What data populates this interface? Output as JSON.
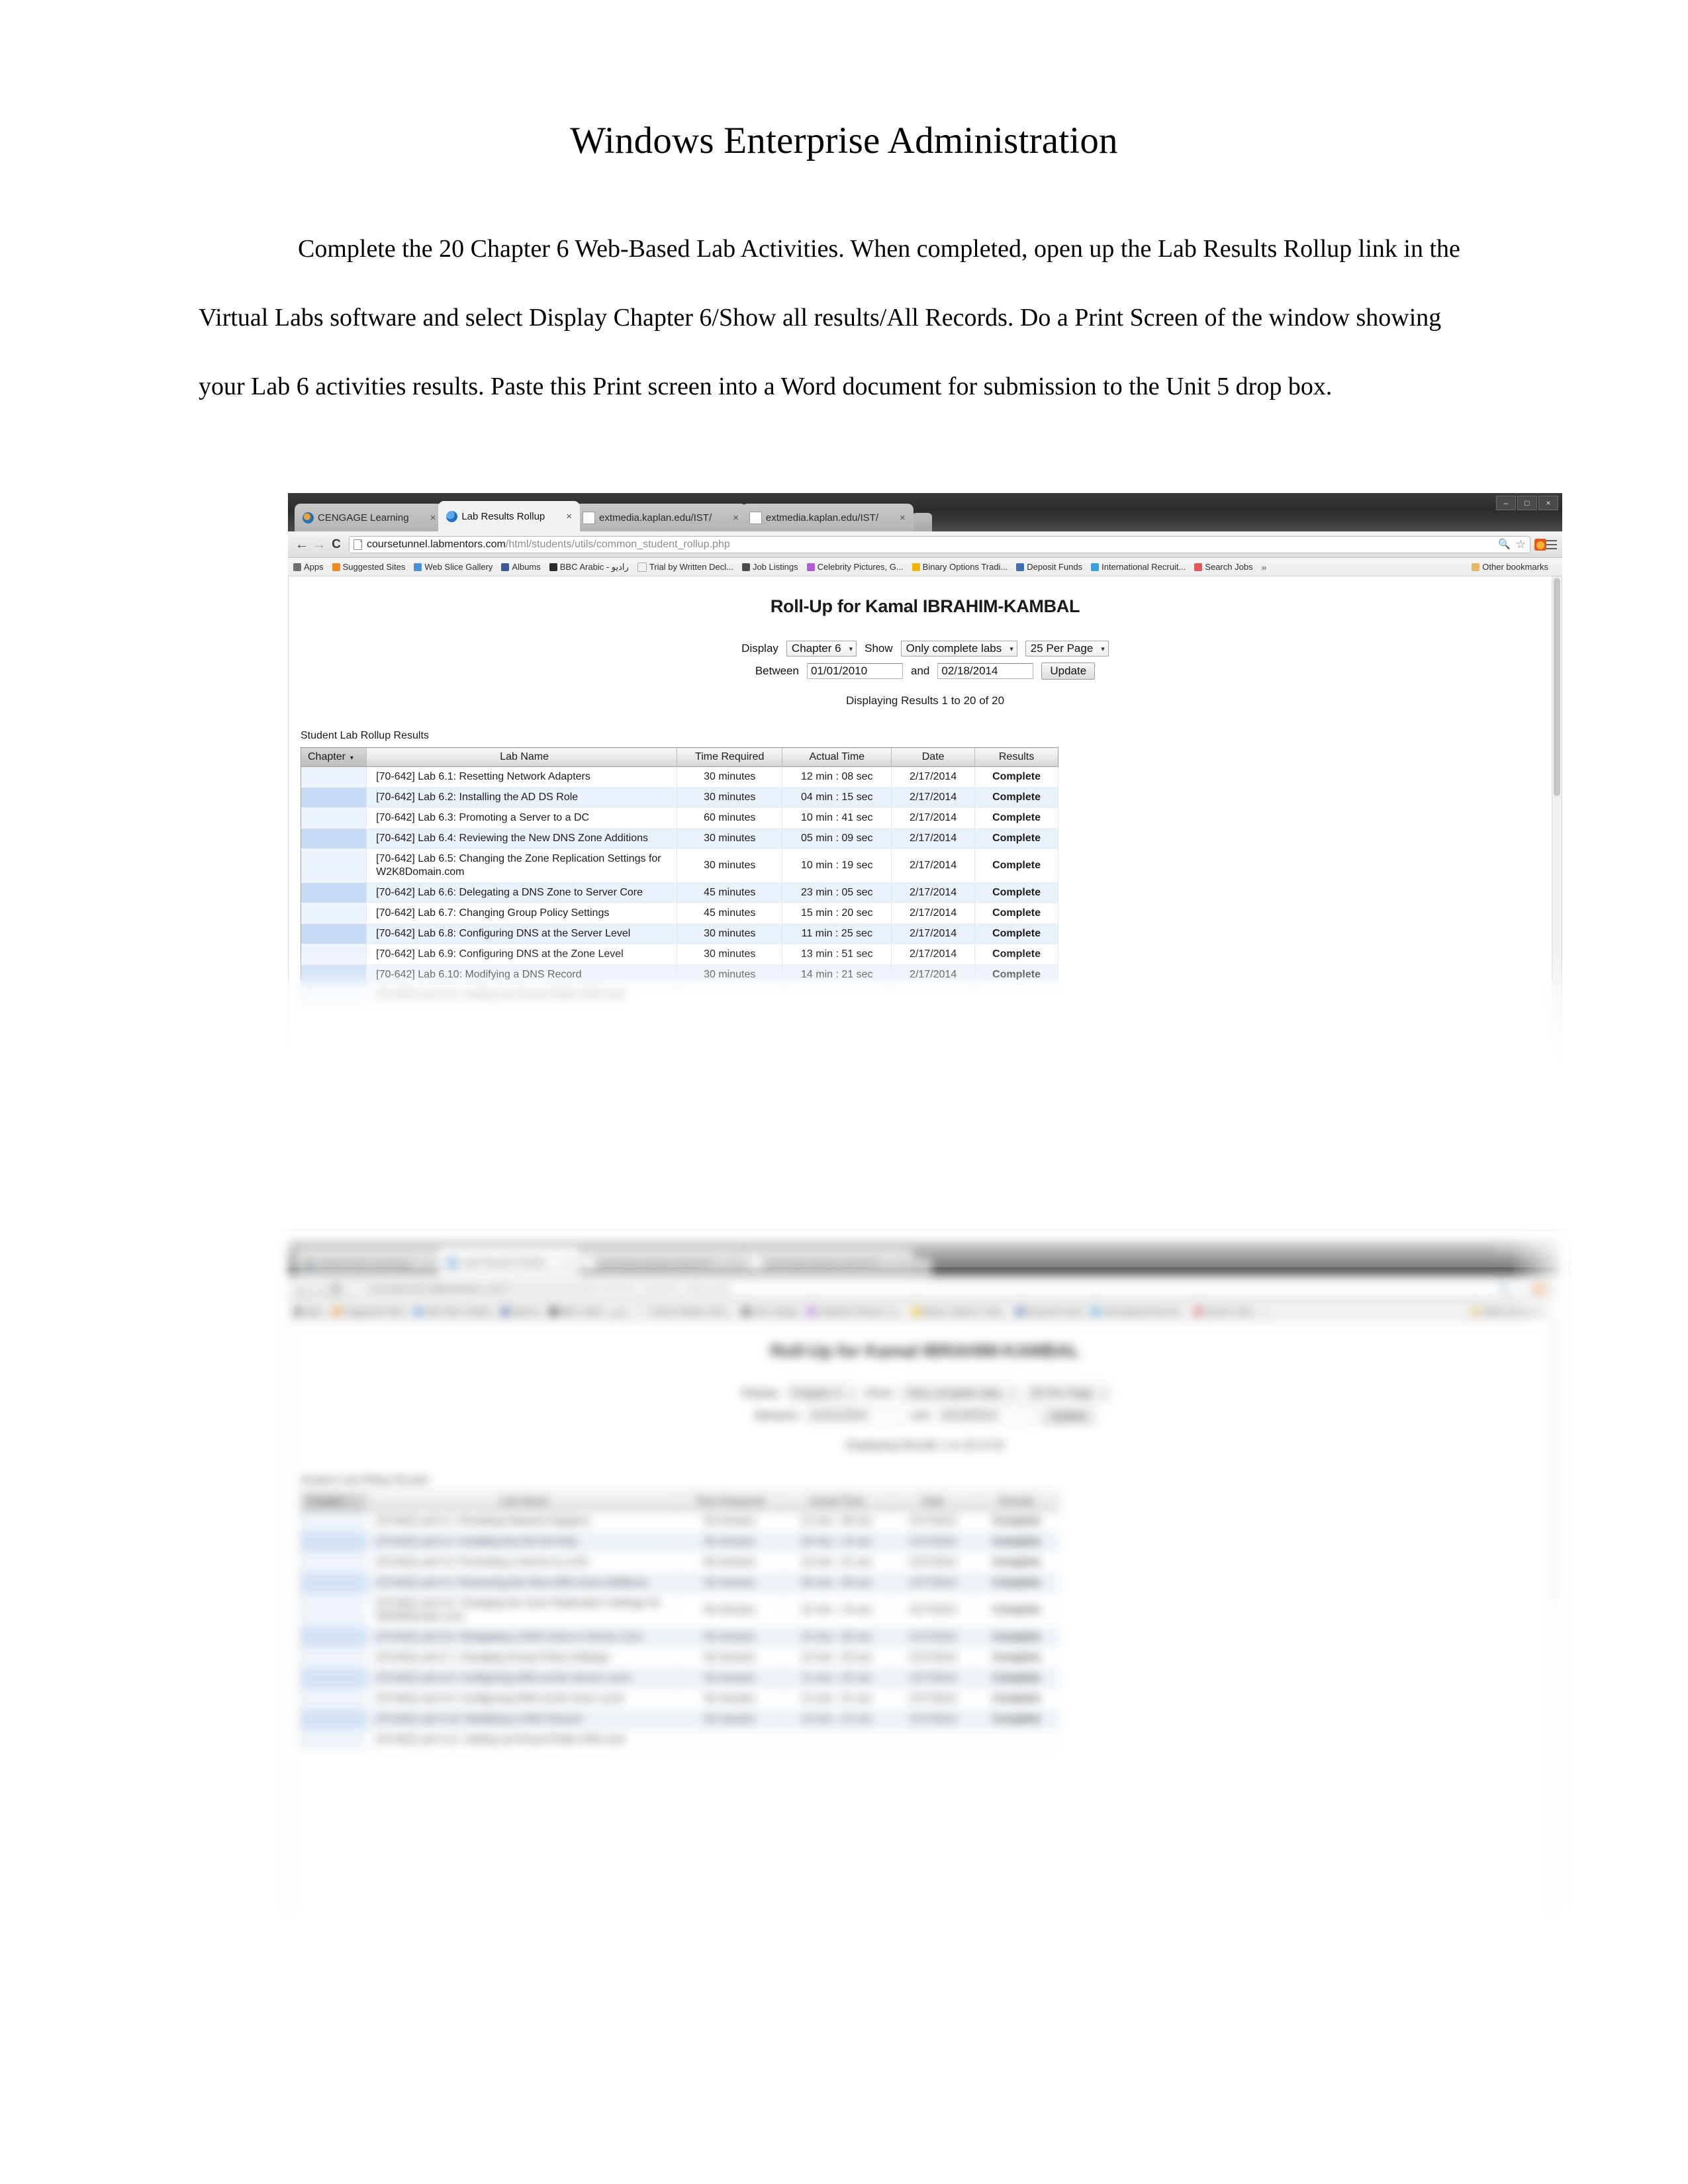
{
  "document": {
    "title": "Windows Enterprise Administration",
    "body": "Complete the 20 Chapter 6 Web-Based Lab Activities. When completed, open up the Lab Results Rollup link in the Virtual Labs software and select Display Chapter 6/Show all results/All Records. Do a Print Screen of the window showing your Lab 6 activities results. Paste this Print screen into a Word document for submission to the Unit 5 drop box."
  },
  "browser": {
    "tabs": [
      {
        "title": "CENGAGE Learning",
        "favicon": "cengage-icon",
        "close": "×",
        "active": false
      },
      {
        "title": "Lab Results Rollup",
        "favicon": "globe-icon",
        "close": "×",
        "active": true
      },
      {
        "title": "extmedia.kaplan.edu/IST/",
        "favicon": "page-icon",
        "close": "×",
        "active": false
      },
      {
        "title": "extmedia.kaplan.edu/IST/",
        "favicon": "page-icon",
        "close": "×",
        "active": false
      }
    ],
    "window_controls": {
      "minimize": "–",
      "maximize": "□",
      "close": "×"
    },
    "nav": {
      "back": "←",
      "forward": "→",
      "reload": "C"
    },
    "omnibox": {
      "domain": "coursetunnel.labmentors.com",
      "path": "/html/students/utils/common_student_rollup.php",
      "zoom_icon": "zoom-in-icon",
      "star_icon": "star-icon"
    },
    "bookmarks": [
      {
        "label": "Apps",
        "color": "#6f6f6f"
      },
      {
        "label": "Suggested Sites",
        "color": "#f08a24"
      },
      {
        "label": "Web Slice Gallery",
        "color": "#4a90d9"
      },
      {
        "label": "Albums",
        "color": "#3b5998"
      },
      {
        "label": "BBC Arabic - راديو",
        "color": "#2b2b2b"
      },
      {
        "label": "Trial by Written Decl...",
        "color": "#d9d9d9"
      },
      {
        "label": "Job Listings",
        "color": "#4c4c4c"
      },
      {
        "label": "Celebrity Pictures, G...",
        "color": "#b15bd8"
      },
      {
        "label": "Binary Options Tradi...",
        "color": "#f2b500"
      },
      {
        "label": "Deposit Funds",
        "color": "#3f6fb0"
      },
      {
        "label": "International Recruit...",
        "color": "#38a0dc"
      },
      {
        "label": "Search Jobs",
        "color": "#e05a5a"
      }
    ],
    "bookmarks_overflow": "»",
    "other_bookmarks": "Other bookmarks"
  },
  "page": {
    "heading": "Roll-Up for Kamal IBRAHIM-KAMBAL",
    "controls": {
      "display_label": "Display",
      "display_value": "Chapter 6",
      "show_label": "Show",
      "show_value": "Only complete labs",
      "per_page_value": "25 Per Page",
      "between_label": "Between",
      "date_from": "01/01/2010",
      "and_label": "and",
      "date_to": "02/18/2014",
      "update_label": "Update",
      "caret": "▾"
    },
    "displaying": "Displaying Results 1 to 20 of 20",
    "section_label": "Student Lab Rollup Results",
    "table": {
      "columns": [
        "Chapter",
        "Lab Name",
        "Time Required",
        "Actual Time",
        "Date",
        "Results"
      ],
      "sort_caret": "▾",
      "rows": [
        {
          "chapter": "",
          "name": "[70-642] Lab 6.1: Resetting Network Adapters",
          "required": "30 minutes",
          "actual": "12 min : 08 sec",
          "date": "2/17/2014",
          "result": "Complete"
        },
        {
          "chapter": "",
          "name": "[70-642] Lab 6.2: Installing the AD DS Role",
          "required": "30 minutes",
          "actual": "04 min : 15 sec",
          "date": "2/17/2014",
          "result": "Complete"
        },
        {
          "chapter": "",
          "name": "[70-642] Lab 6.3: Promoting a Server to a DC",
          "required": "60 minutes",
          "actual": "10 min : 41 sec",
          "date": "2/17/2014",
          "result": "Complete"
        },
        {
          "chapter": "",
          "name": "[70-642] Lab 6.4: Reviewing the New DNS Zone Additions",
          "required": "30 minutes",
          "actual": "05 min : 09 sec",
          "date": "2/17/2014",
          "result": "Complete"
        },
        {
          "chapter": "",
          "name": "[70-642] Lab 6.5: Changing the Zone Replication Settings for W2K8Domain.com",
          "required": "30 minutes",
          "actual": "10 min : 19 sec",
          "date": "2/17/2014",
          "result": "Complete"
        },
        {
          "chapter": "",
          "name": "[70-642] Lab 6.6: Delegating a DNS Zone to Server Core",
          "required": "45 minutes",
          "actual": "23 min : 05 sec",
          "date": "2/17/2014",
          "result": "Complete"
        },
        {
          "chapter": "",
          "name": "[70-642] Lab 6.7: Changing Group Policy Settings",
          "required": "45 minutes",
          "actual": "15 min : 20 sec",
          "date": "2/17/2014",
          "result": "Complete"
        },
        {
          "chapter": "",
          "name": "[70-642] Lab 6.8: Configuring DNS at the Server Level",
          "required": "30 minutes",
          "actual": "11 min : 25 sec",
          "date": "2/17/2014",
          "result": "Complete"
        },
        {
          "chapter": "",
          "name": "[70-642] Lab 6.9: Configuring DNS at the Zone Level",
          "required": "30 minutes",
          "actual": "13 min : 51 sec",
          "date": "2/17/2014",
          "result": "Complete"
        },
        {
          "chapter": "",
          "name": "[70-642] Lab 6.10: Modifying a DNS Record",
          "required": "30 minutes",
          "actual": "14 min : 21 sec",
          "date": "2/17/2014",
          "result": "Complete"
        },
        {
          "chapter": "",
          "name": "[70-642] Lab 6.11: Setting Up Round Robin DNS and",
          "required": "",
          "actual": "",
          "date": "",
          "result": ""
        }
      ]
    }
  }
}
